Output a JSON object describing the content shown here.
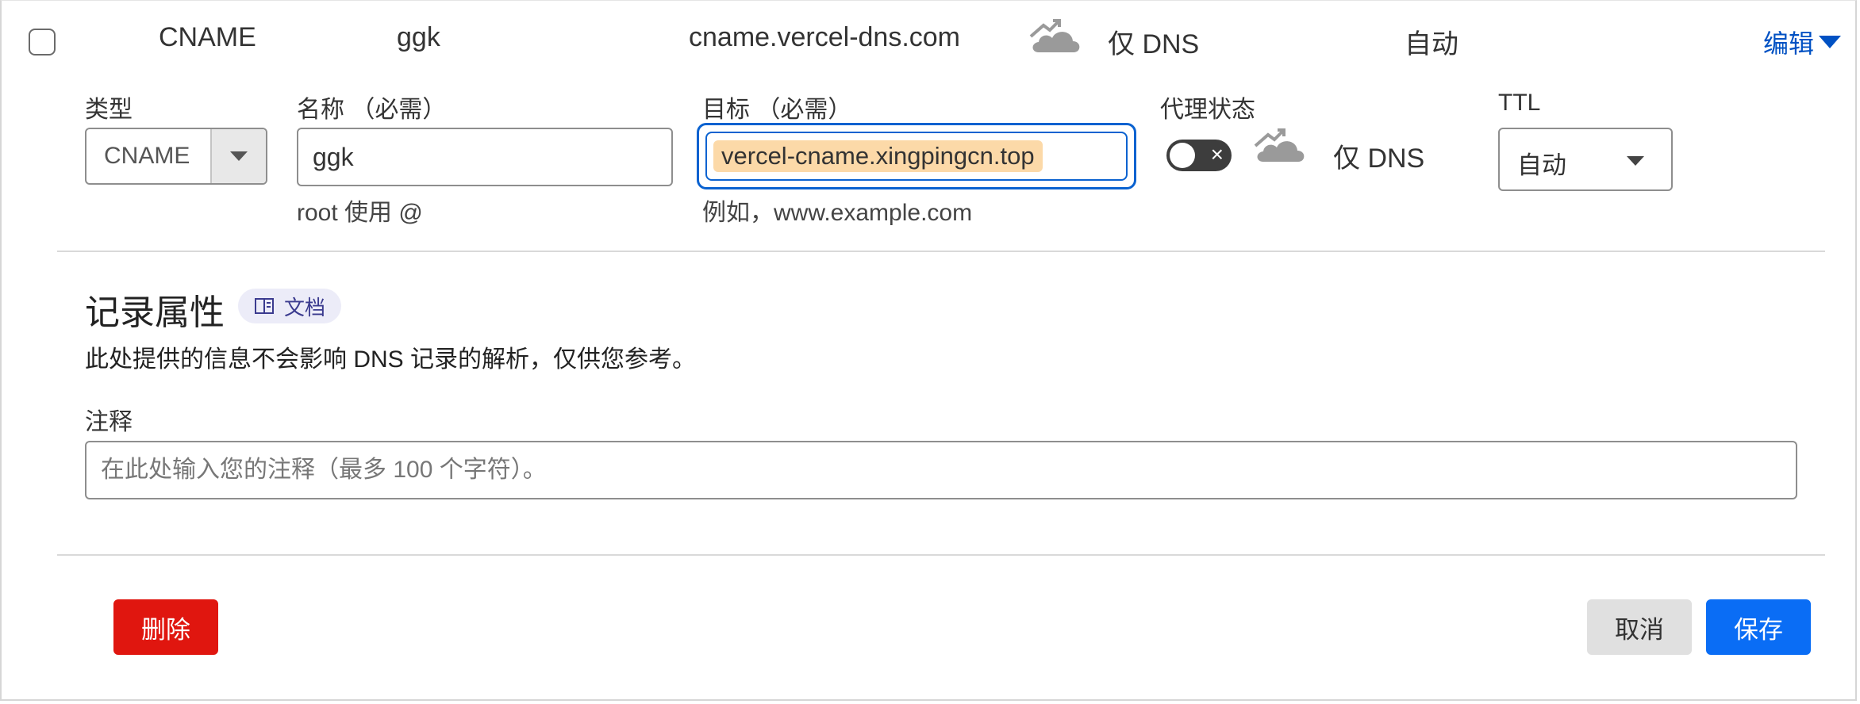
{
  "record": {
    "type": "CNAME",
    "name": "ggk",
    "content": "cname.vercel-dns.com",
    "proxy_status": "仅 DNS",
    "ttl": "自动",
    "edit_label": "编辑"
  },
  "form": {
    "type_label": "类型",
    "type_value": "CNAME",
    "name_label": "名称 （必需）",
    "name_value": "ggk",
    "name_hint": "root 使用 @",
    "target_label": "目标 （必需）",
    "target_value": "vercel-cname.xingpingcn.top",
    "target_hint": "例如，www.example.com",
    "proxy_label": "代理状态",
    "proxy_toggle": "×",
    "proxy_value": "仅 DNS",
    "ttl_label": "TTL",
    "ttl_value": "自动"
  },
  "attributes": {
    "title": "记录属性",
    "docs_label": "文档",
    "description": "此处提供的信息不会影响 DNS 记录的解析，仅供您参考。",
    "comment_label": "注释",
    "comment_placeholder": "在此处输入您的注释（最多 100 个字符）。"
  },
  "actions": {
    "delete_label": "删除",
    "cancel_label": "取消",
    "save_label": "保存"
  },
  "colors": {
    "accent": "#0051c3",
    "delete": "#e0160f",
    "save": "#0a6df5",
    "highlight": "#fcd9a8"
  },
  "icons": [
    "checkbox",
    "dns-only-cloud-icon",
    "chevron-down-icon",
    "book-icon",
    "toggle-off"
  ]
}
